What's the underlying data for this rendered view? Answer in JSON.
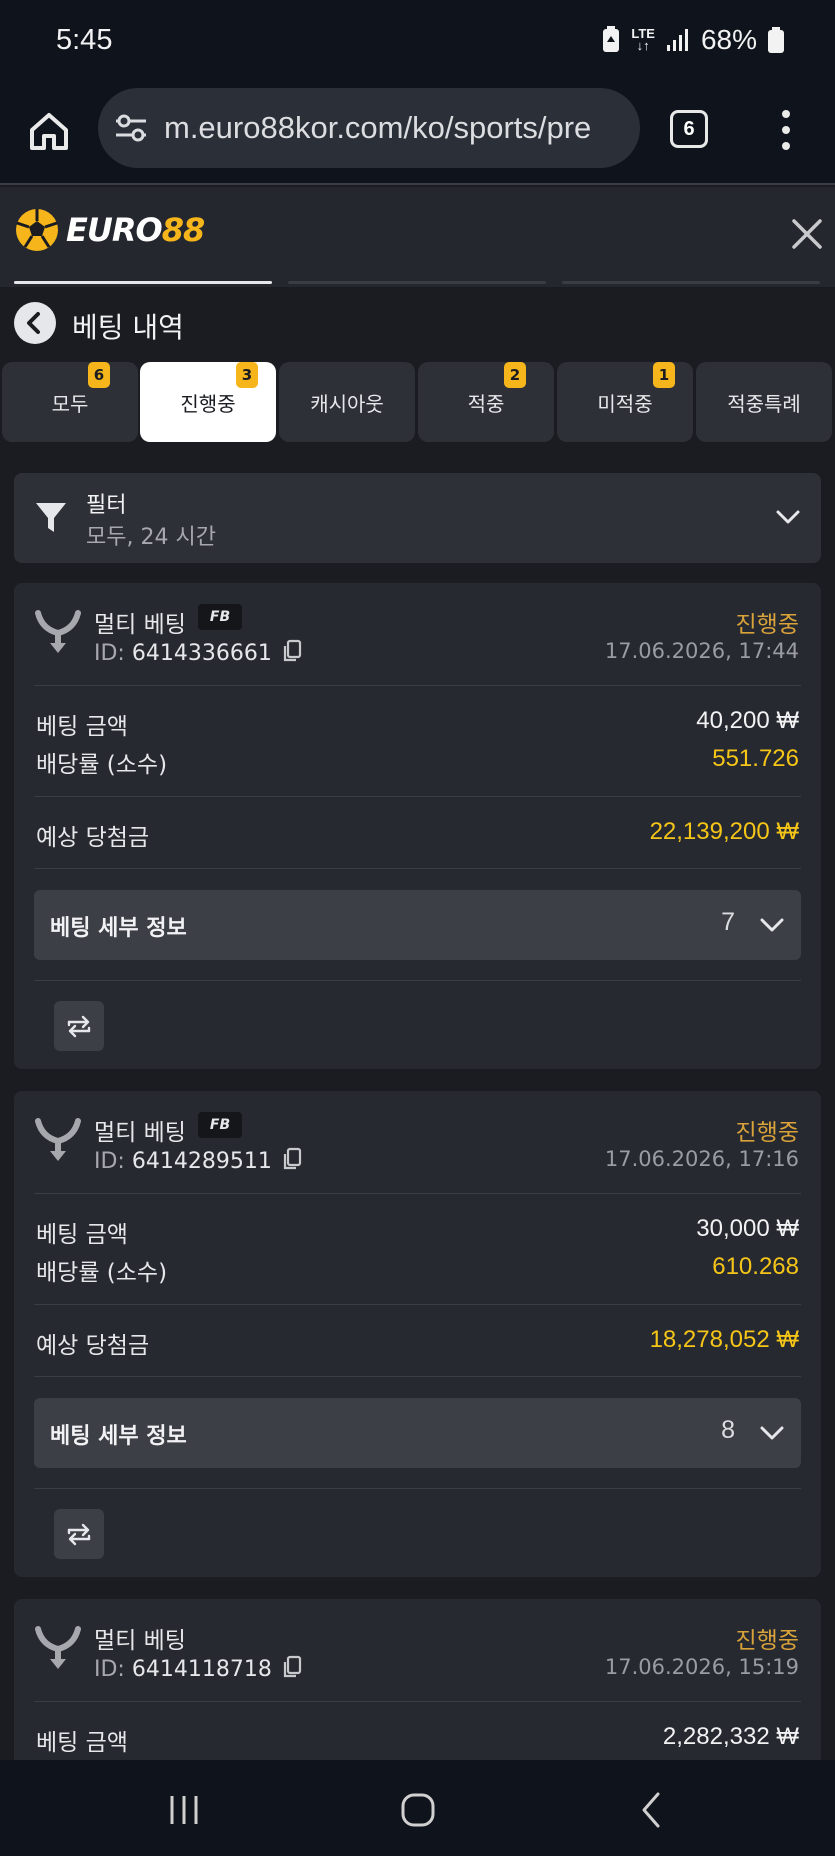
{
  "statusbar": {
    "time": "5:45",
    "network": "LTE",
    "battery": "68%"
  },
  "browser": {
    "url": "m.euro88kor.com/ko/sports/pre",
    "tab_count": "6"
  },
  "site": {
    "logo_a": "EURO",
    "logo_b": "88"
  },
  "page": {
    "title": "베팅 내역"
  },
  "tabs": [
    {
      "label": "모두",
      "badge": "6"
    },
    {
      "label": "진행중",
      "badge": "3"
    },
    {
      "label": "캐시아웃",
      "badge": ""
    },
    {
      "label": "적중",
      "badge": "2"
    },
    {
      "label": "미적중",
      "badge": "1"
    },
    {
      "label": "적중특례",
      "badge": ""
    }
  ],
  "filter": {
    "title": "필터",
    "value": "모두, 24 시간"
  },
  "labels": {
    "stake": "베팅 금액",
    "odds": "배당률 (소수)",
    "potential": "예상 당첨금",
    "details": "베팅 세부 정보",
    "id_prefix": "ID:"
  },
  "bets": [
    {
      "type": "멀티 베팅",
      "badge": "FB",
      "id": "6414336661",
      "status": "진행중",
      "date": "17.06.2026, 17:44",
      "stake": "40,200 ₩",
      "odds": "551.726",
      "potential": "22,139,200 ₩",
      "selections": "7"
    },
    {
      "type": "멀티 베팅",
      "badge": "FB",
      "id": "6414289511",
      "status": "진행중",
      "date": "17.06.2026, 17:16",
      "stake": "30,000 ₩",
      "odds": "610.268",
      "potential": "18,278,052 ₩",
      "selections": "8"
    },
    {
      "type": "멀티 베팅",
      "badge": "",
      "id": "6414118718",
      "status": "진행중",
      "date": "17.06.2026, 15:19",
      "stake": "2,282,332 ₩"
    }
  ],
  "colors": {
    "accent": "#f5b51b",
    "status": "#d9a23a",
    "gold_value": "#f5c518",
    "card": "#26292f"
  }
}
